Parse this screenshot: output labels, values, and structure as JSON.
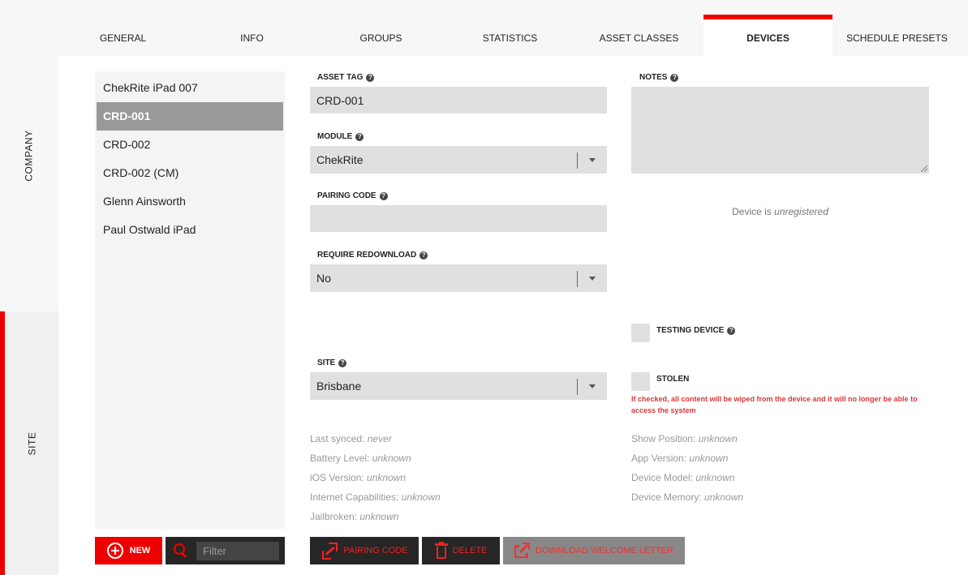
{
  "rail": {
    "company_label": "COMPANY",
    "site_label": "SITE"
  },
  "tabs": [
    {
      "label": "GENERAL"
    },
    {
      "label": "INFO"
    },
    {
      "label": "GROUPS"
    },
    {
      "label": "STATISTICS"
    },
    {
      "label": "ASSET CLASSES"
    },
    {
      "label": "DEVICES",
      "active": true
    },
    {
      "label": "SCHEDULE PRESETS"
    }
  ],
  "devices": {
    "items": [
      {
        "label": "ChekRite iPad 007"
      },
      {
        "label": "CRD-001",
        "selected": true
      },
      {
        "label": "CRD-002"
      },
      {
        "label": "CRD-002 (CM)"
      },
      {
        "label": "Glenn Ainsworth"
      },
      {
        "label": "Paul Ostwald iPad"
      }
    ],
    "new_label": "NEW",
    "filter_placeholder": "Filter"
  },
  "form": {
    "asset_tag": {
      "label": "ASSET TAG",
      "value": "CRD-001"
    },
    "module": {
      "label": "MODULE",
      "value": "ChekRite"
    },
    "pairing_code": {
      "label": "PAIRING CODE",
      "value": ""
    },
    "require_redownload": {
      "label": "REQUIRE REDOWNLOAD",
      "value": "No"
    },
    "site": {
      "label": "SITE",
      "value": "Brisbane"
    },
    "notes": {
      "label": "NOTES",
      "value": ""
    },
    "device_status_prefix": "Device is",
    "device_status": "unregistered",
    "testing_device": {
      "label": "TESTING DEVICE",
      "checked": false
    },
    "stolen": {
      "label": "STOLEN",
      "checked": false
    },
    "stolen_warning": "If checked, all content will be wiped from the device and it will no longer be able to access the system"
  },
  "info_left": [
    {
      "key": "Last synced:",
      "value": "never"
    },
    {
      "key": "Battery Level:",
      "value": "unknown"
    },
    {
      "key": "iOS Version:",
      "value": "unknown"
    },
    {
      "key": "Internet Capabilities:",
      "value": "unknown"
    },
    {
      "key": "Jailbroken:",
      "value": "unknown"
    }
  ],
  "info_right": [
    {
      "key": "Show Position:",
      "value": "unknown"
    },
    {
      "key": "App Version:",
      "value": "unknown"
    },
    {
      "key": "Device Model:",
      "value": "unknown"
    },
    {
      "key": "Device Memory:",
      "value": "unknown"
    }
  ],
  "actions": {
    "pairing_code": "PAIRING CODE",
    "delete": "DELETE",
    "download_welcome_letter": "DOWNLOAD WELCOME LETTER"
  },
  "colors": {
    "accent": "#ee0000",
    "selected_row": "#999999",
    "dark_button": "#262626",
    "field_bg": "#e0e0e0",
    "warning": "#d83838"
  }
}
